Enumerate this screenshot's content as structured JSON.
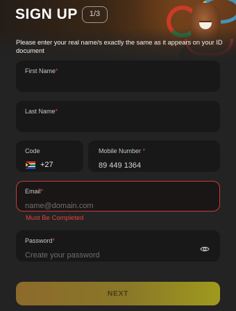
{
  "header": {
    "title": "SIGN UP",
    "step": "1/3",
    "instruction": "Please enter your real name/s exactly the same as it appears on your ID document"
  },
  "form": {
    "first_name": {
      "label": "First Name",
      "required_mark": "*"
    },
    "last_name": {
      "label": "Last Name",
      "required_mark": "*"
    },
    "code": {
      "label": "Code",
      "flag_icon": "south-africa-flag-icon",
      "value": "+27"
    },
    "mobile": {
      "label": "Mobile Number",
      "required_mark": "*",
      "value": "89 449 1364"
    },
    "email": {
      "label": "Email",
      "required_mark": "*",
      "placeholder": "name@domain.com",
      "error": "Must Be Completed"
    },
    "password": {
      "label": "Password",
      "required_mark": "*",
      "placeholder": "Create your password",
      "toggle_icon": "eye-icon"
    }
  },
  "actions": {
    "next_label": "NEXT"
  },
  "colors": {
    "background": "#232323",
    "field_background": "#181818",
    "error": "#e2453b",
    "button_gradient_start": "#8c6a2b",
    "button_gradient_end": "#9f9a1d"
  }
}
